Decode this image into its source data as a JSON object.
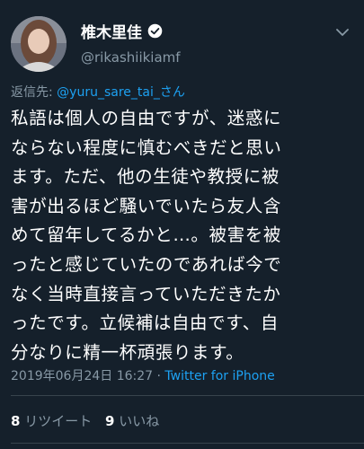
{
  "user": {
    "display_name": "椎木里佳",
    "handle": "@rikashiikiamf"
  },
  "reply": {
    "prefix": "返信先: ",
    "mention": "@yuru_sare_tai_さん"
  },
  "tweet": {
    "lines": [
      "私語は個人の自由ですが、迷惑に",
      "ならない程度に慎むべきだと思い",
      "ます。ただ、他の生徒や教授に被",
      "害が出るほど騒いでいたら友人含",
      "めて留年してるかと…。被害を被",
      "ったと感じていたのであれば今で",
      "なく当時直接言っていただきたか",
      "ったです。立候補は自由です、自",
      "分なりに精一杯頑張ります。"
    ]
  },
  "meta": {
    "timestamp": "2019年06月24日 16:27",
    "separator": " · ",
    "source": "Twitter for iPhone"
  },
  "stats": {
    "retweet_count": "8",
    "retweet_label": "リツイート",
    "like_count": "9",
    "like_label": "いいね"
  },
  "colors": {
    "background": "#15202b",
    "accent": "#1da1f2",
    "muted": "#8899a6",
    "divider": "#38444d"
  },
  "icons": {
    "verified": "verified-badge-icon",
    "menu": "chevron-down-icon"
  }
}
